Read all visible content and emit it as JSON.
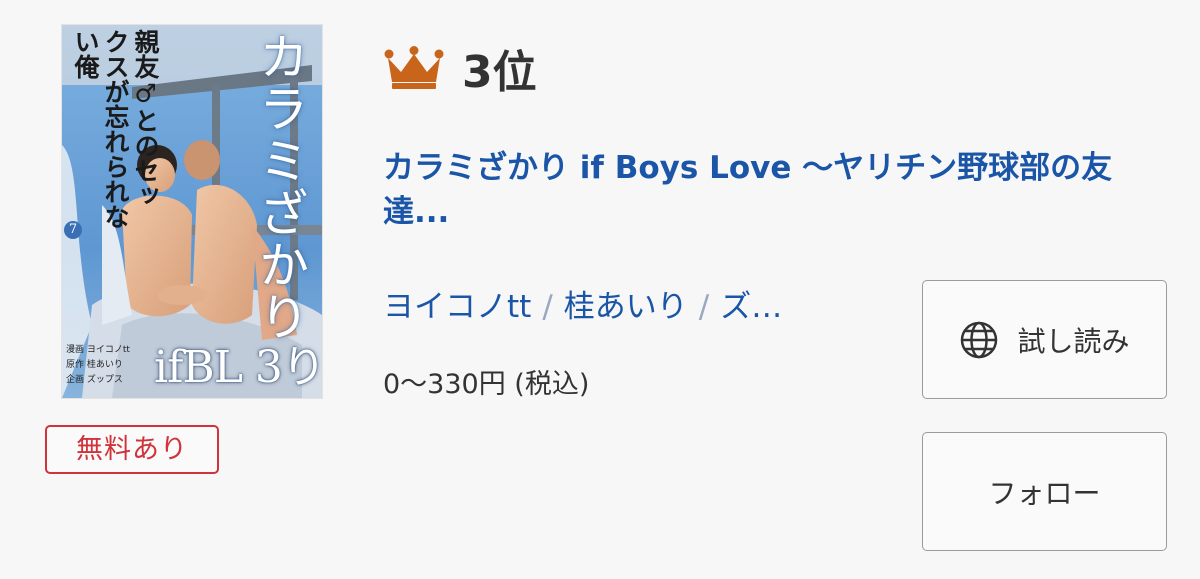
{
  "cover": {
    "title_vertical": "カラミざかり",
    "subtitle_vertical": "親友♂とのセックスが忘れられない俺",
    "volume": "7",
    "credits": [
      "漫画 ヨイコノtt",
      "原作 桂あいり",
      "企画 ズップス"
    ],
    "logo": "ifBL 3り"
  },
  "badge": {
    "label": "無料あり",
    "color": "#d1333a"
  },
  "rank": {
    "icon": "crown-icon",
    "label": "3位",
    "crown_color": "#c8651b"
  },
  "title": "カラミざかり if Boys Love 〜ヤリチン野球部の友達...",
  "authors": [
    {
      "name": "ヨイコノtt"
    },
    {
      "name": "桂あいり"
    },
    {
      "name": "ズ…"
    }
  ],
  "separator": "/",
  "price": "0〜330円 (税込)",
  "buttons": {
    "read": {
      "label": "試し読み",
      "icon": "globe-icon"
    },
    "follow": {
      "label": "フォロー"
    }
  },
  "colors": {
    "link": "#1a55a8",
    "badge_red": "#d1333a",
    "background": "#f7f7f7"
  }
}
